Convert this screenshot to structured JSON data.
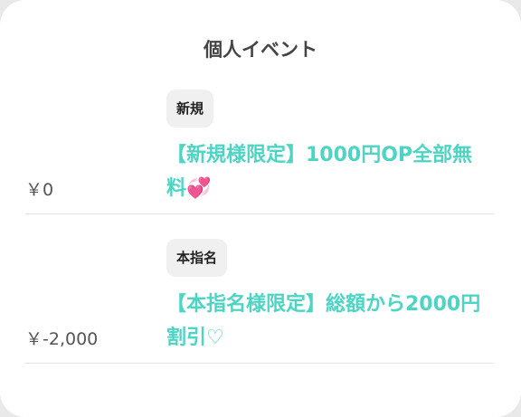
{
  "section": {
    "title": "個人イベント"
  },
  "events": [
    {
      "badge": "新規",
      "title": "【新規様限定】1000円OP全部無料💞",
      "price": "￥0"
    },
    {
      "badge": "本指名",
      "title": "【本指名様限定】総額から2000円割引♡",
      "price": "￥-2,000"
    }
  ],
  "colors": {
    "accent": "#4dd5c4",
    "badge_bg": "#f0f0f1",
    "divider": "#e2e2e2"
  }
}
